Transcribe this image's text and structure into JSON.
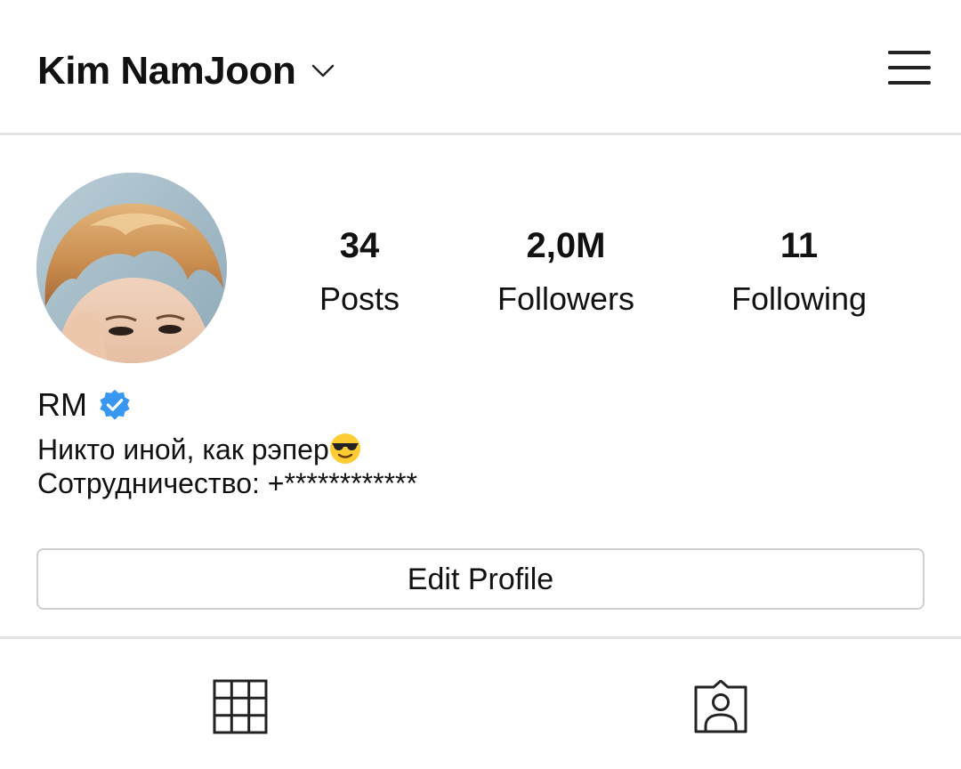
{
  "header": {
    "username": "Kim NamJoon",
    "switch_icon": "chevron-down-icon",
    "menu_icon": "hamburger-menu-icon"
  },
  "profile": {
    "avatar_icon": "profile-avatar",
    "stats": [
      {
        "value": "34",
        "label": "Posts"
      },
      {
        "value": "2,0M",
        "label": "Followers"
      },
      {
        "value": "11",
        "label": "Following"
      }
    ],
    "display_name": "RM",
    "verified_icon": "verified-badge-icon",
    "verified_color": "#3897f0",
    "bio_line1": "Никто иной, как рэпер",
    "bio_line1_emoji": "sunglasses-emoji-icon",
    "bio_line2": "Сотрудничество: +************",
    "edit_button_label": "Edit Profile"
  },
  "tabs": [
    {
      "name": "grid",
      "icon": "grid-icon"
    },
    {
      "name": "tagged",
      "icon": "tagged-person-icon"
    }
  ]
}
